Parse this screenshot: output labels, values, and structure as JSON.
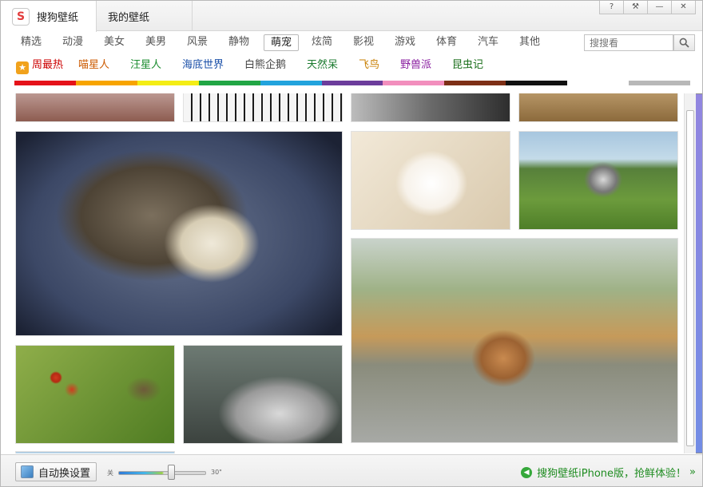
{
  "tabs": [
    {
      "label": "搜狗壁纸",
      "icon": "sogou-logo-icon"
    },
    {
      "label": "我的壁纸",
      "icon": "gallery-icon"
    }
  ],
  "window_controls": {
    "help": "?",
    "settings": "⚒",
    "minimize": "—",
    "close": "✕"
  },
  "categories": [
    "精选",
    "动漫",
    "美女",
    "美男",
    "风景",
    "静物",
    "萌宠",
    "炫简",
    "影视",
    "游戏",
    "体育",
    "汽车",
    "其他"
  ],
  "active_category": "萌宠",
  "search": {
    "placeholder": "搜搜看"
  },
  "subcategories": [
    {
      "label": "周最热",
      "color": "#cc0000"
    },
    {
      "label": "喵星人",
      "color": "#cc5a00"
    },
    {
      "label": "汪星人",
      "color": "#1a8c2e"
    },
    {
      "label": "海底世界",
      "color": "#1a4fa8"
    },
    {
      "label": "白熊企鹅",
      "color": "#444444"
    },
    {
      "label": "天然呆",
      "color": "#1a7a2e"
    },
    {
      "label": "飞鸟",
      "color": "#c77e00"
    },
    {
      "label": "野兽派",
      "color": "#8a1fa0"
    },
    {
      "label": "昆虫记",
      "color": "#1a6e1a"
    }
  ],
  "color_filters": [
    "#e5121a",
    "#f7a400",
    "#f4ed15",
    "#21a645",
    "#22a3dd",
    "#6c3d9c",
    "#f28ebd",
    "#7d2f16",
    "#111111",
    "#ffffff",
    "#b8b8b8"
  ],
  "footer": {
    "auto_change_label": "自动换设置",
    "slider_min": "关",
    "slider_max": "30\"",
    "slider_value": 0.6,
    "promo_text": "搜狗壁纸iPhone版，抢鲜体验！",
    "promo_arrow": "»"
  }
}
